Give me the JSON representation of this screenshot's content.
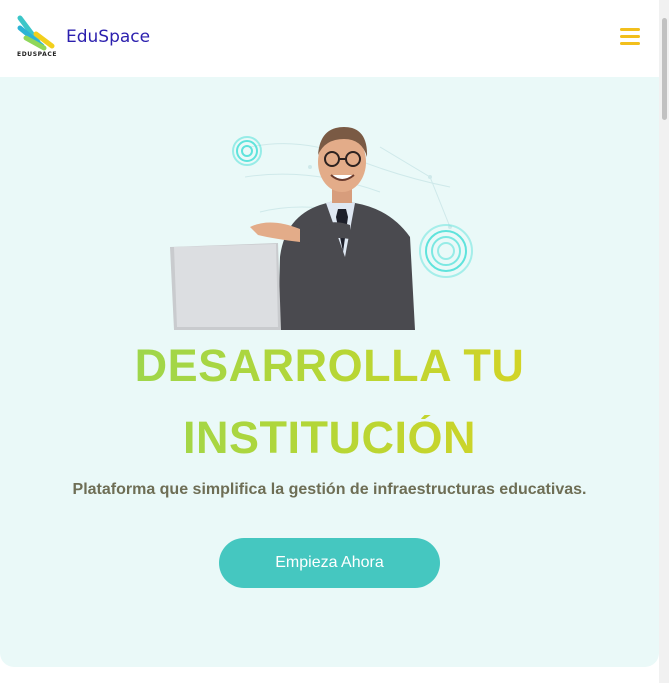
{
  "header": {
    "logo_caption": "EDUSPACE",
    "brand": "EduSpace",
    "menu_icon": "hamburger-menu-icon"
  },
  "hero": {
    "title_line1": "DESARROLLA TU",
    "title_line2": "INSTITUCIÓN",
    "subtitle": "Plataforma que simplifica la gestión de infraestructuras educativas.",
    "cta_label": "Empieza Ahora",
    "image": "businessman-with-laptop-illustration"
  },
  "colors": {
    "brand_text": "#2b1fae",
    "menu_accent": "#f2bf1c",
    "hero_background": "#eaf9f8",
    "cta_background": "#45c7c0",
    "title_gradient_start": "#8fd75a",
    "title_gradient_end": "#e6d21b",
    "subtitle_text": "#6e6e55"
  }
}
